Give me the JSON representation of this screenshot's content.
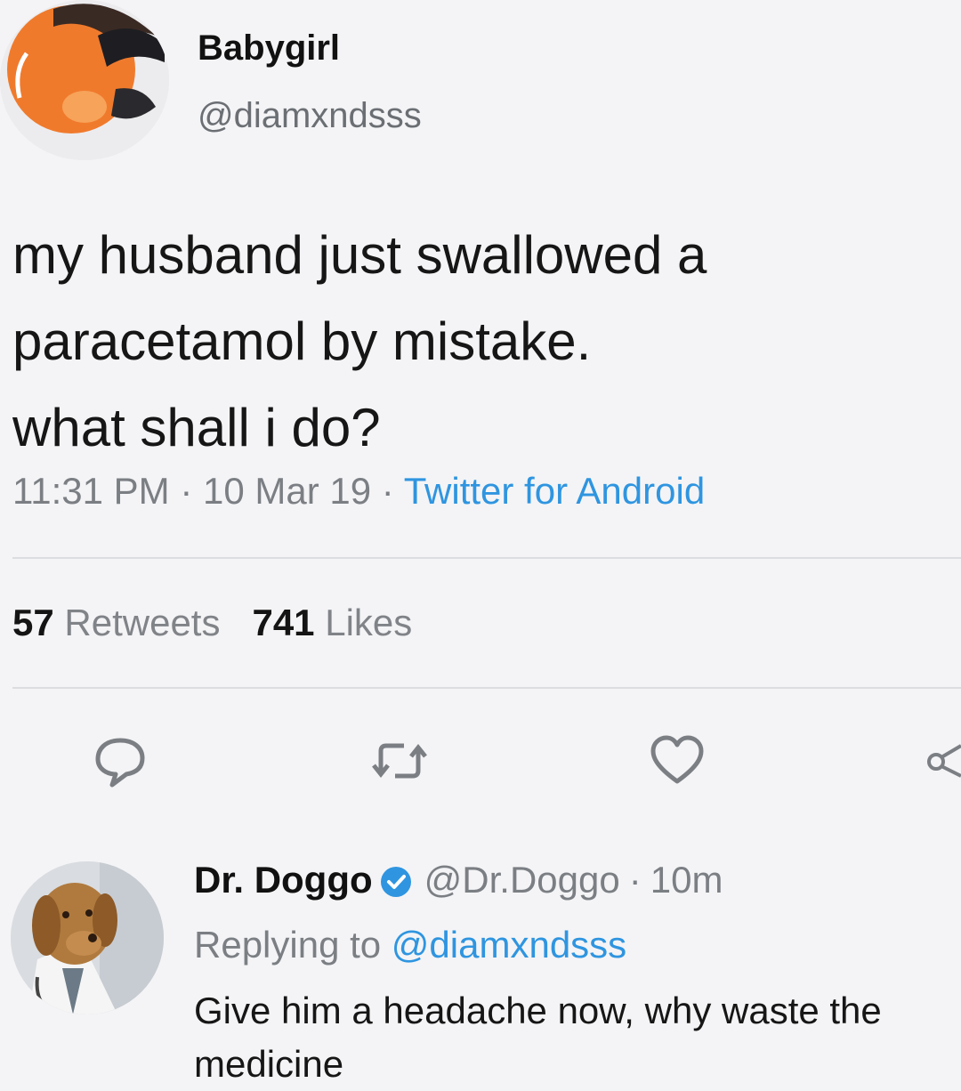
{
  "tweet": {
    "author": {
      "name": "Babygirl",
      "handle": "@diamxndsss",
      "avatar_icon": "profile-photo-orange"
    },
    "text_lines": [
      "my husband just swallowed a",
      "paracetamol by mistake.",
      "what shall i do?"
    ],
    "time": "11:31 PM",
    "date": "10 Mar 19",
    "separator": "·",
    "source": "Twitter for Android",
    "stats": {
      "retweets_count": "57",
      "retweets_label": "Retweets",
      "likes_count": "741",
      "likes_label": "Likes"
    },
    "actions": [
      "reply-icon",
      "retweet-icon",
      "like-icon",
      "share-icon"
    ]
  },
  "reply": {
    "author": {
      "name": "Dr. Doggo",
      "handle": "@Dr.Doggo",
      "verified": true,
      "avatar_icon": "dog-doctor-photo"
    },
    "time": "10m",
    "replying_to_label": "Replying to",
    "replying_to_handle": "@diamxndsss",
    "text_lines": [
      "Give him a headache now, why waste the",
      "medicine"
    ]
  },
  "colors": {
    "background": "#f4f4f6",
    "accent": "#2f95e0",
    "muted_text": "#7b7f84",
    "avatar_orange": "#f07a2c"
  }
}
